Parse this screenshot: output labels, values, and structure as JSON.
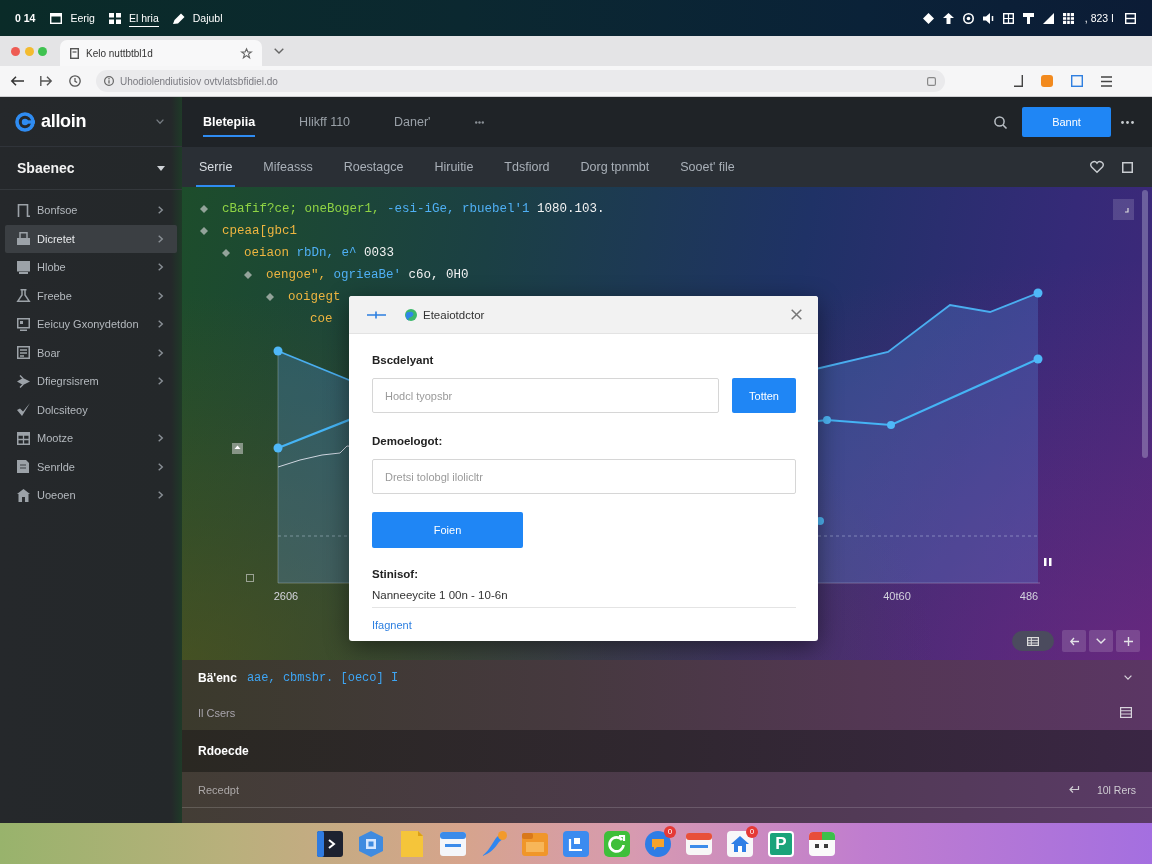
{
  "system_bar": {
    "time": "0 14",
    "menus": [
      {
        "label": "Eerig",
        "selected": false
      },
      {
        "label": "El hria",
        "selected": true
      },
      {
        "label": "Dajubl",
        "selected": false
      }
    ],
    "status_text": ", 823 I"
  },
  "browser": {
    "tab_title": "Kelo nuttbtbl1d",
    "url": "Uhodiolendiutisiov ovtvlatsbfidiel.do"
  },
  "sidebar": {
    "app_name": "alloin",
    "section": "Sbaenec",
    "items": [
      {
        "label": "Bonfsoe",
        "selected": false,
        "expandable": true
      },
      {
        "label": "Dicretet",
        "selected": true,
        "expandable": true
      },
      {
        "label": "Hlobe",
        "selected": false,
        "expandable": true
      },
      {
        "label": "Freebe",
        "selected": false,
        "expandable": true
      },
      {
        "label": "Eeicuy Gxonydetdon",
        "selected": false,
        "expandable": true
      },
      {
        "label": "Boar",
        "selected": false,
        "expandable": true
      },
      {
        "label": "Dfiegrsisrem",
        "selected": false,
        "expandable": true
      },
      {
        "label": "Dolcsiteoy",
        "selected": false,
        "expandable": false
      },
      {
        "label": "Mootze",
        "selected": false,
        "expandable": true
      },
      {
        "label": "Senrlde",
        "selected": false,
        "expandable": true
      },
      {
        "label": "Uoeoen",
        "selected": false,
        "expandable": true
      }
    ]
  },
  "header": {
    "tabs": [
      {
        "label": "Bletepiia",
        "selected": true
      },
      {
        "label": "Hlikff 110",
        "selected": false
      },
      {
        "label": "Daner'",
        "selected": false
      }
    ],
    "action_button": "Bannt"
  },
  "subnav": {
    "tabs": [
      {
        "label": "Serrie",
        "selected": true
      },
      {
        "label": "Mifeasss",
        "selected": false
      },
      {
        "label": "Roestagce",
        "selected": false
      },
      {
        "label": "Hiruitie",
        "selected": false
      },
      {
        "label": "Tdsfiord",
        "selected": false
      },
      {
        "label": "Dorg tpnmbt",
        "selected": false
      },
      {
        "label": "Sooet' file",
        "selected": false
      }
    ]
  },
  "code": {
    "lines": [
      {
        "toggle": true,
        "tokens": [
          {
            "text": "cBafif?ce; oneBoger1,",
            "kind": "keyword"
          },
          {
            "text": "-esi-iGe, rbuebel'1",
            "kind": "name"
          },
          {
            "text": "1080.103.",
            "kind": "number"
          }
        ]
      },
      {
        "toggle": true,
        "tokens": [
          {
            "text": "cpeaa[gbc1",
            "kind": "string"
          }
        ],
        "children": [
          {
            "toggle": true,
            "tokens": [
              {
                "text": "oeiaon",
                "kind": "string"
              },
              {
                "text": "rbDn, e^",
                "kind": "name"
              },
              {
                "text": "0033",
                "kind": "number"
              }
            ],
            "children": [
              {
                "toggle": true,
                "tokens": [
                  {
                    "text": "oengoe\",",
                    "kind": "string"
                  },
                  {
                    "text": "ogrieaBe'",
                    "kind": "name"
                  },
                  {
                    "text": "c6o,",
                    "kind": "number"
                  },
                  {
                    "text": "0H0",
                    "kind": "number"
                  }
                ],
                "children": [
                  {
                    "toggle": true,
                    "tokens": [
                      {
                        "text": "ooigegt",
                        "kind": "string"
                      }
                    ],
                    "children": [
                      {
                        "toggle": false,
                        "tokens": [
                          {
                            "text": "coe",
                            "kind": "string"
                          }
                        ]
                      }
                    ]
                  }
                ]
              }
            ]
          }
        ]
      }
    ]
  },
  "chart": {
    "axis_labels": [
      "2606",
      "40t60",
      "486"
    ]
  },
  "dialog": {
    "title": "Eteaiotdctor",
    "fields": [
      {
        "label": "Bscdelyant",
        "placeholder": "Hodcl tyopsbr",
        "button": "Totten"
      },
      {
        "label": "Demoelogot:",
        "placeholder": "Dretsi tolobgl ilolicltr"
      }
    ],
    "submit_button": "Foien",
    "result_label": "Stinisof:",
    "result": "Nanneeycite 1 00n - 10-6n",
    "link": "Ifagnent"
  },
  "results_panel": {
    "title": "Bä'enc",
    "code": "aae, cbmsbr. [oeco] I",
    "subtitle": "Il Csers"
  },
  "records": {
    "title": "Rdoecde",
    "rows": [
      {
        "label": "Recedpt",
        "value": "10l Rers"
      }
    ]
  },
  "dock": {
    "apps": [
      {
        "kind": "icon",
        "has_badge": false
      },
      {
        "kind": "icon",
        "has_badge": false
      },
      {
        "kind": "icon",
        "has_badge": false
      },
      {
        "kind": "icon",
        "has_badge": false
      },
      {
        "kind": "icon",
        "has_badge": false
      },
      {
        "kind": "icon",
        "has_badge": false
      },
      {
        "kind": "icon",
        "has_badge": false
      },
      {
        "kind": "icon",
        "has_badge": false
      },
      {
        "kind": "icon",
        "has_badge": true,
        "badge": "0"
      },
      {
        "kind": "icon",
        "has_badge": false
      },
      {
        "kind": "icon",
        "has_badge": true,
        "badge": "0"
      },
      {
        "kind": "letter",
        "label": "P",
        "has_badge": false
      },
      {
        "kind": "icon",
        "has_badge": false
      }
    ]
  }
}
